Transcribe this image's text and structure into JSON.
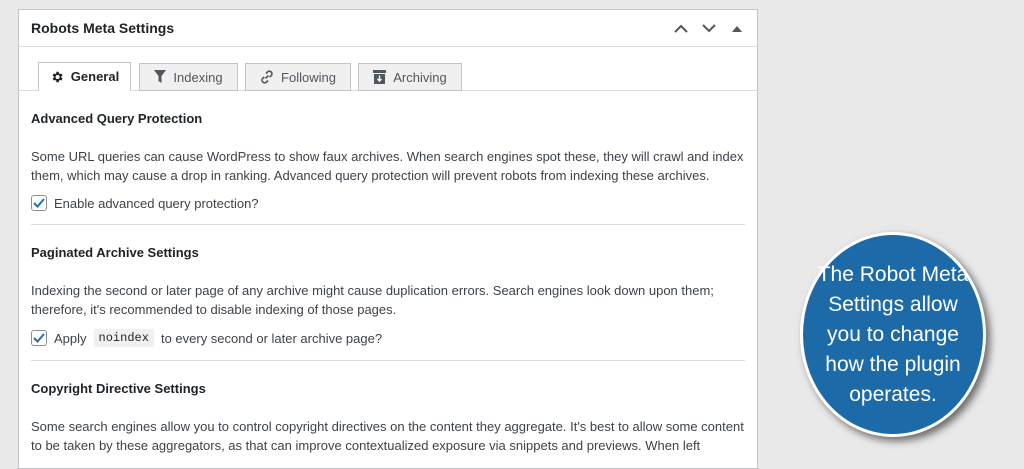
{
  "panel": {
    "title": "Robots Meta Settings"
  },
  "tabs": [
    {
      "label": "General",
      "icon": "gear-icon"
    },
    {
      "label": "Indexing",
      "icon": "filter-icon"
    },
    {
      "label": "Following",
      "icon": "link-icon"
    },
    {
      "label": "Archiving",
      "icon": "archive-icon"
    }
  ],
  "sections": {
    "query": {
      "heading": "Advanced Query Protection",
      "description": "Some URL queries can cause WordPress to show faux archives. When search engines spot these, they will crawl and index them, which may cause a drop in ranking. Advanced query protection will prevent robots from indexing these archives.",
      "checkbox_label": "Enable advanced query protection?",
      "checked": true
    },
    "paginated": {
      "heading": "Paginated Archive Settings",
      "description": "Indexing the second or later page of any archive might cause duplication errors. Search engines look down upon them; therefore, it's recommended to disable indexing of those pages.",
      "checkbox_pre": "Apply",
      "checkbox_code": "noindex",
      "checkbox_post": "to every second or later archive page?",
      "checked": true
    },
    "copyright": {
      "heading": "Copyright Directive Settings",
      "description": "Some search engines allow you to control copyright directives on the content they aggregate. It's best to allow some content to be taken by these aggregators, as that can improve contextualized exposure via snippets and previews. When left"
    }
  },
  "callout": {
    "text": "The Robot Meta Settings allow you to change how the plugin operates."
  },
  "colors": {
    "accent": "#2271b1",
    "check": "#2271b1",
    "bubble": "#1c6aa8"
  }
}
